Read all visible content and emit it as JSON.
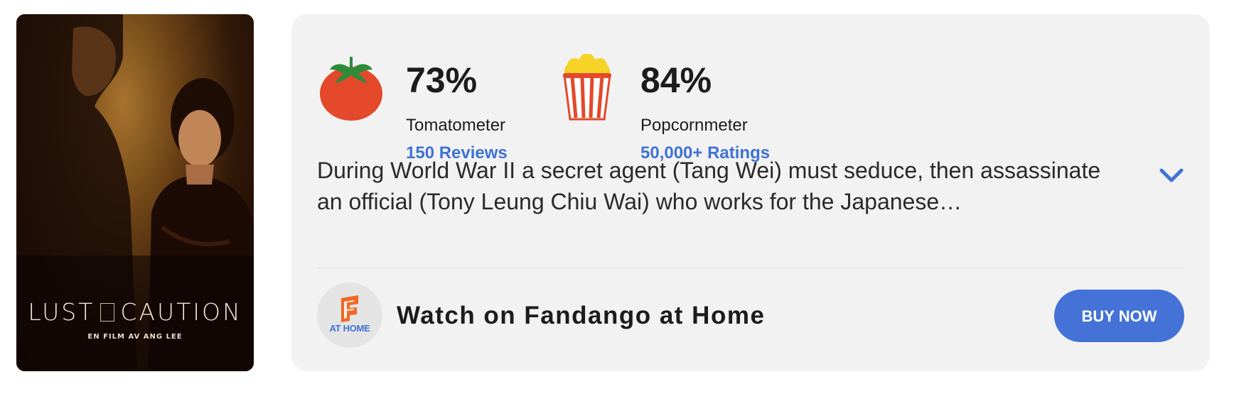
{
  "poster": {
    "title_left": "LUST",
    "title_right": "CAUTION",
    "subtitle": "EN FILM AV ANG LEE"
  },
  "tomatometer": {
    "value": "73%",
    "label": "Tomatometer",
    "link": "150 Reviews",
    "icon": "tomato-icon"
  },
  "popcornmeter": {
    "value": "84%",
    "label": "Popcornmeter",
    "link": "50,000+ Ratings",
    "icon": "popcorn-icon"
  },
  "synopsis": "During World War II a secret agent (Tang Wei) must seduce, then assassinate an official (Tony Leung Chiu Wai) who works for the Japanese…",
  "watch": {
    "logo_text": "AT HOME",
    "text": "Watch on Fandango at Home",
    "button": "BUY NOW"
  },
  "colors": {
    "accent": "#3f72d6",
    "card_bg": "#f2f2f2",
    "tomato_red": "#e3492a",
    "fandango_orange": "#f26722"
  }
}
